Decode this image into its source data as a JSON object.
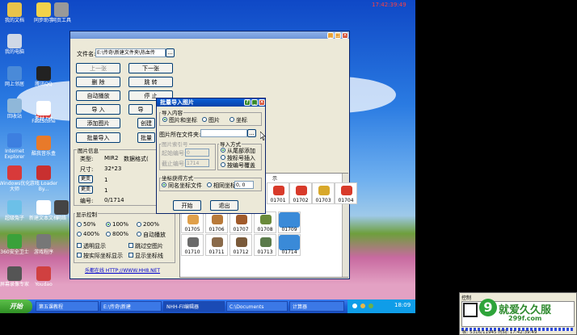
{
  "clock_top": "17:42:39:49",
  "desktop_icons": [
    {
      "label": "我的文档",
      "color": "#e8c34a"
    },
    {
      "label": "我的电脑",
      "color": "#cfd8e6"
    },
    {
      "label": "网上邻居",
      "color": "#4a8ad8"
    },
    {
      "label": "回收站",
      "color": "#8fb7d9"
    },
    {
      "label": "Internet Explorer",
      "color": "#3d7fe0"
    },
    {
      "label": "Windows优化大师",
      "color": "#d83a3a"
    },
    {
      "label": "超级兔子",
      "color": "#6cc0e8"
    },
    {
      "label": "360安全卫士",
      "color": "#3aa13a"
    },
    {
      "label": "屏幕录像专家",
      "color": "#555555"
    },
    {
      "label": "酷我音乐盒",
      "color": "#e87a2a"
    },
    {
      "label": "FastStone",
      "color": "#d84040"
    },
    {
      "label": "同步助手",
      "color": "#f2d24a"
    },
    {
      "label": "腾讯QQ",
      "color": "#222222"
    },
    {
      "label": "素材.txt",
      "color": "#ffffff"
    },
    {
      "label": "游戏 Loader By...",
      "color": "#c83030"
    },
    {
      "label": "新建文本文档",
      "color": "#ffffff"
    },
    {
      "label": "网页工具",
      "color": "#999999"
    },
    {
      "label": "Youdao",
      "color": "#d04040"
    },
    {
      "label": "网络",
      "color": "#444444"
    },
    {
      "label": "游戏程序",
      "color": "#777777"
    }
  ],
  "main_window": {
    "file_label": "文件名:",
    "file_path": "E:\\传奇\\新建文件夹\\热血传",
    "browse": "...",
    "buttons_left": [
      "上一张",
      "删 除",
      "自动播放",
      "导 入",
      "添加图片",
      "批量导入"
    ],
    "buttons_right": [
      "下一张",
      "跳 转",
      "停 止",
      "导",
      "创建",
      "批量"
    ],
    "info_title": "图片信息",
    "info": [
      {
        "k": "类型:",
        "v": "MIR2"
      },
      {
        "k": "尺寸:",
        "v": "32*23"
      },
      {
        "k": "编号:",
        "v": "0/1714"
      }
    ],
    "data_format_label": "数据格式(",
    "change_btn": "更变",
    "change_values": [
      "1",
      "1"
    ],
    "display_title": "显示控制",
    "zoom_options": [
      "50%",
      "100%",
      "200%",
      "400%",
      "800%",
      "自动播放"
    ],
    "zoom_selected": 1,
    "checks": [
      "透明显示",
      "跳过空图片",
      "按实际坐标显示",
      "显示坐标线"
    ],
    "link": "乐都在线 HTTP://WWW.HH8.NET"
  },
  "dialog": {
    "title": "批量导入图片",
    "import_content_title": "导入内容",
    "import_content_opts": [
      "图片和坐标",
      "图片",
      "坐标"
    ],
    "folder_label": "图片所在文件夹:",
    "folder_btn": "...",
    "index_title": "图片索引号",
    "start_label": "起始编号:",
    "start_value": "0",
    "end_label": "截止编号:",
    "end_value": "1714",
    "method_title": "导入方式",
    "method_opts": [
      "从尾部添加",
      "按标号插入",
      "按编号覆盖"
    ],
    "coord_title": "坐标获得方式",
    "coord_opts": [
      "同名坐标文件",
      "相同坐标"
    ],
    "coord_value": "0, 0",
    "ok": "开始",
    "cancel": "退出"
  },
  "grid_header": "示",
  "grid_labels": [
    "01701",
    "01702",
    "01703",
    "01704",
    "01705",
    "01706",
    "01707",
    "01708",
    "01709",
    "01710",
    "01711",
    "01712",
    "01713",
    "01714"
  ],
  "taskbar": {
    "start": "开始",
    "tasks": [
      "第五课教程",
      "E:\\传奇\\新建",
      "NHH-Fil编辑器",
      "C:\\Documents",
      "计算器"
    ],
    "clock": "18:09"
  },
  "right_panel": {
    "title": "控制",
    "watermark": "就爱久久服",
    "domain": "299f.com",
    "status": "帧: 5316/11945 时间: 17:42:39:49"
  }
}
